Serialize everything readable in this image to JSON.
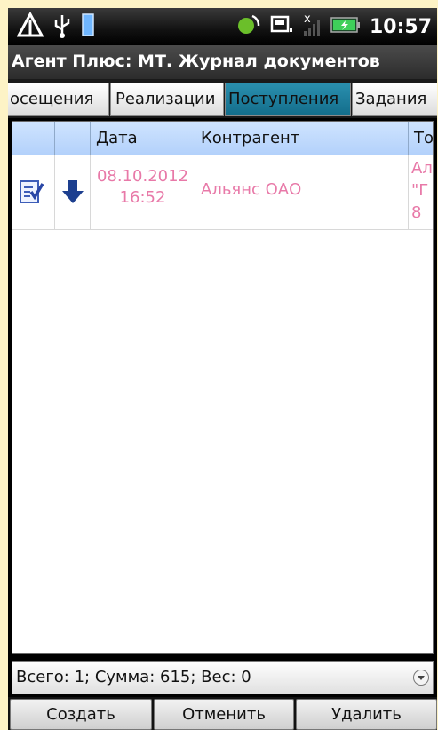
{
  "status_bar": {
    "time": "10:57",
    "left_icons": [
      "warning-icon",
      "usb-icon",
      "sd-card-icon"
    ],
    "right_icons": [
      "sync-icon",
      "notification-icon",
      "signal-icon",
      "battery-icon"
    ]
  },
  "app": {
    "title": "Агент Плюс: МТ. Журнал документов"
  },
  "tabs": [
    {
      "label": "осещения",
      "active": false
    },
    {
      "label": "Реализации",
      "active": false
    },
    {
      "label": "Поступления",
      "active": true
    },
    {
      "label": "Задания",
      "active": false
    }
  ],
  "table": {
    "columns": [
      "",
      "",
      "Дата",
      "Контрагент",
      "То"
    ],
    "rows": [
      {
        "status_icon": "document-check-icon",
        "type_icon": "arrow-down-icon",
        "date_line1": "08.10.2012",
        "date_line2": "16:52",
        "counterparty": "Альянс ОАО",
        "extra_line1": "Ал",
        "extra_line2": "\"Г",
        "extra_line3": "8"
      }
    ]
  },
  "summary": {
    "text": "Всего: 1; Сумма: 615; Вес: 0"
  },
  "buttons": {
    "create": "Создать",
    "cancel": "Отменить",
    "delete": "Удалить"
  },
  "colors": {
    "accent_tab": "#1d7f9e",
    "row_text": "#e879a8",
    "header_bg": "#c3dcfd"
  }
}
